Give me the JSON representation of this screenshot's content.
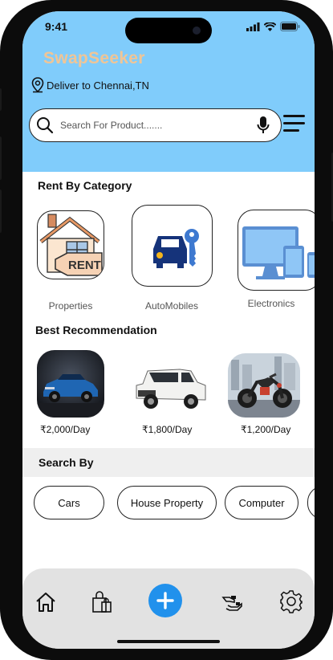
{
  "status": {
    "time": "9:41"
  },
  "brand": {
    "name": "SwapSeeker"
  },
  "deliver": {
    "text": "Deliver to Chennai,TN"
  },
  "search": {
    "placeholder": "Search For Product......."
  },
  "rent_by_category": {
    "title": "Rent By Category",
    "items": [
      {
        "label": "Properties",
        "icon": "house-rent-icon"
      },
      {
        "label": "AutoMobiles",
        "icon": "car-key-icon"
      },
      {
        "label": "Electronics",
        "icon": "devices-icon"
      }
    ]
  },
  "best_recommendation": {
    "title": "Best Recommendation",
    "items": [
      {
        "price": "₹2,000/Day",
        "image": "blue-suv"
      },
      {
        "price": "₹1,800/Day",
        "image": "white-jeep"
      },
      {
        "price": "₹1,200/Day",
        "image": "motorcycle"
      }
    ]
  },
  "search_by": {
    "title": "Search By",
    "chips": [
      "Cars",
      "House Property",
      "Computer",
      ""
    ]
  },
  "bottom_nav": {
    "items": [
      "home-icon",
      "bag-icon",
      "add-icon",
      "hand-icon",
      "settings-icon"
    ]
  },
  "colors": {
    "header": "#80ccfb",
    "brand": "#f0c596",
    "accent": "#2191ec"
  }
}
